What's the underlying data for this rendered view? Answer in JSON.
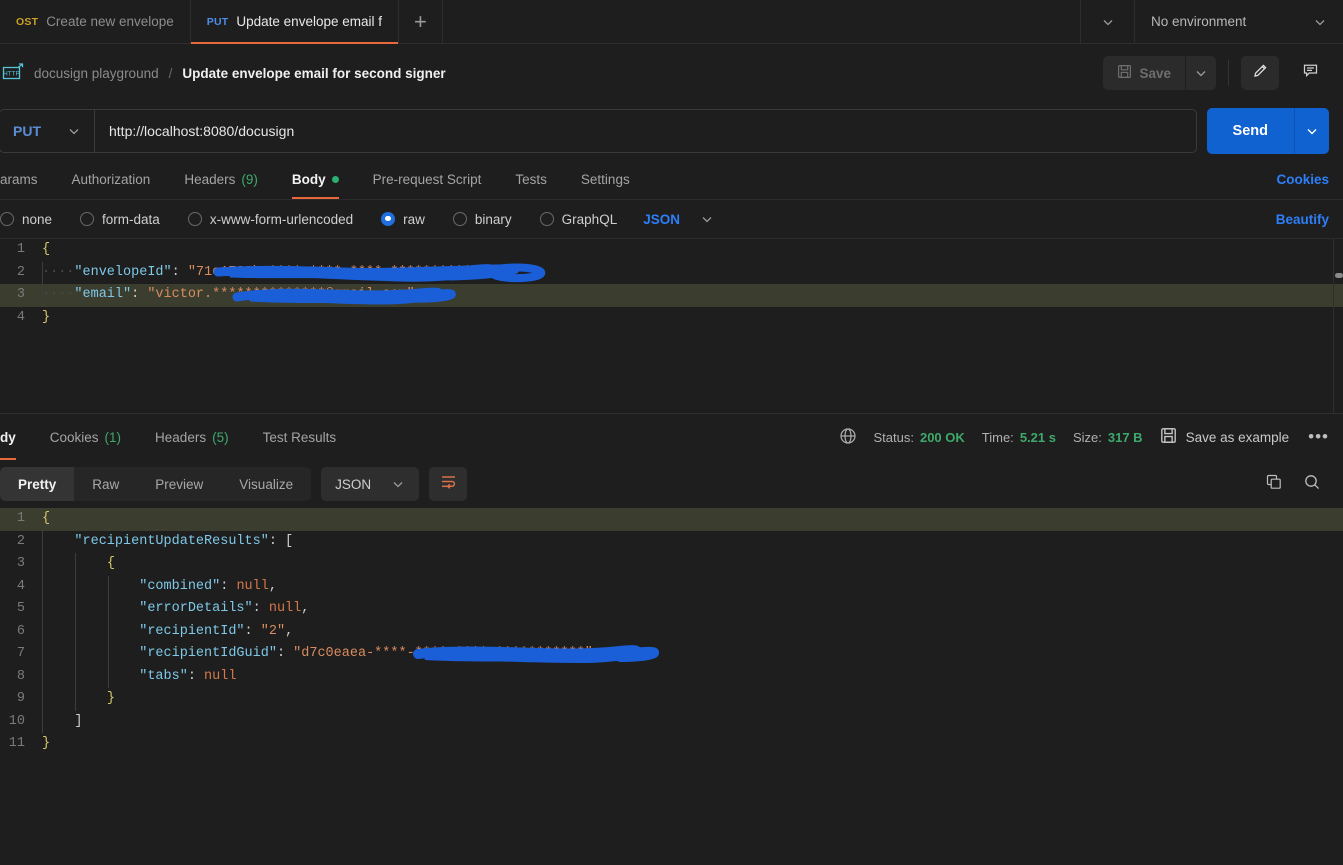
{
  "tabbar": {
    "tabs": [
      {
        "method": "OST",
        "label": "Create new envelope",
        "active": false
      },
      {
        "method": "PUT",
        "label": "Update envelope email f",
        "active": true
      }
    ],
    "add_label": "+",
    "environment": "No environment",
    "chevron_icon": "chevron-down-icon"
  },
  "breadcrumb": {
    "protocol_icon": "http-icon",
    "collection": "docusign playground",
    "separator": "/",
    "title": "Update envelope email for second signer",
    "save_label": "Save",
    "save_icon": "floppy-disk-icon",
    "caret_icon": "chevron-down-icon",
    "edit_icon": "pencil-icon",
    "comment_icon": "comment-icon"
  },
  "url": {
    "method": "PUT",
    "value": "http://localhost:8080/docusign",
    "send_label": "Send",
    "send_caret_icon": "chevron-down-icon",
    "method_caret_icon": "chevron-down-icon"
  },
  "request_tabs": {
    "items": [
      {
        "label": "arams",
        "count": "",
        "active": false,
        "dot": false
      },
      {
        "label": "Authorization",
        "count": "",
        "active": false,
        "dot": false
      },
      {
        "label": "Headers",
        "count": "(9)",
        "active": false,
        "dot": false
      },
      {
        "label": "Body",
        "count": "",
        "active": true,
        "dot": true
      },
      {
        "label": "Pre-request Script",
        "count": "",
        "active": false,
        "dot": false
      },
      {
        "label": "Tests",
        "count": "",
        "active": false,
        "dot": false
      },
      {
        "label": "Settings",
        "count": "",
        "active": false,
        "dot": false
      }
    ],
    "cookies_link": "Cookies"
  },
  "body_types": {
    "options": [
      {
        "label": "none",
        "selected": false
      },
      {
        "label": "form-data",
        "selected": false
      },
      {
        "label": "x-www-form-urlencoded",
        "selected": false
      },
      {
        "label": "raw",
        "selected": true
      },
      {
        "label": "binary",
        "selected": false
      },
      {
        "label": "GraphQL",
        "selected": false
      }
    ],
    "format": "JSON",
    "format_caret_icon": "chevron-down-icon",
    "beautify_link": "Beautify"
  },
  "request_body": {
    "lines": [
      {
        "n": "1",
        "text": "{"
      },
      {
        "n": "2",
        "text": "    \"envelopeId\": \"71e1733b-****-****-****-************\","
      },
      {
        "n": "3",
        "text": "    \"email\": \"victor.**************@gmail.com\""
      },
      {
        "n": "4",
        "text": "}"
      }
    ],
    "highlighted_line": 3
  },
  "response_tabs": {
    "items": [
      {
        "label": "dy",
        "count": "",
        "active": true
      },
      {
        "label": "Cookies",
        "count": "(1)",
        "active": false
      },
      {
        "label": "Headers",
        "count": "(5)",
        "active": false
      },
      {
        "label": "Test Results",
        "count": "",
        "active": false
      }
    ],
    "globe_icon": "globe-icon",
    "status_label": "Status:",
    "status_value": "200 OK",
    "time_label": "Time:",
    "time_value": "5.21 s",
    "size_label": "Size:",
    "size_value": "317 B",
    "save_example_label": "Save as example",
    "save_example_icon": "floppy-disk-icon",
    "more_icon": "ellipsis-icon"
  },
  "response_controls": {
    "views": [
      {
        "label": "Pretty",
        "active": true
      },
      {
        "label": "Raw",
        "active": false
      },
      {
        "label": "Preview",
        "active": false
      },
      {
        "label": "Visualize",
        "active": false
      }
    ],
    "format": "JSON",
    "format_caret_icon": "chevron-down-icon",
    "wrap_icon": "wrap-text-icon",
    "copy_icon": "copy-icon",
    "search_icon": "search-icon"
  },
  "response_body": {
    "highlighted_line": 1,
    "lines": [
      {
        "n": "1",
        "segments": [
          {
            "t": "{",
            "c": "k-brace"
          }
        ]
      },
      {
        "n": "2",
        "segments": [
          {
            "t": "    ",
            "c": "k-pun"
          },
          {
            "t": "\"recipientUpdateResults\"",
            "c": "k-key"
          },
          {
            "t": ": [",
            "c": "k-pun"
          }
        ]
      },
      {
        "n": "3",
        "segments": [
          {
            "t": "        ",
            "c": "k-pun"
          },
          {
            "t": "{",
            "c": "k-brace"
          }
        ]
      },
      {
        "n": "4",
        "segments": [
          {
            "t": "            ",
            "c": "k-pun"
          },
          {
            "t": "\"combined\"",
            "c": "k-key"
          },
          {
            "t": ": ",
            "c": "k-pun"
          },
          {
            "t": "null",
            "c": "k-null"
          },
          {
            "t": ",",
            "c": "k-pun"
          }
        ]
      },
      {
        "n": "5",
        "segments": [
          {
            "t": "            ",
            "c": "k-pun"
          },
          {
            "t": "\"errorDetails\"",
            "c": "k-key"
          },
          {
            "t": ": ",
            "c": "k-pun"
          },
          {
            "t": "null",
            "c": "k-null"
          },
          {
            "t": ",",
            "c": "k-pun"
          }
        ]
      },
      {
        "n": "6",
        "segments": [
          {
            "t": "            ",
            "c": "k-pun"
          },
          {
            "t": "\"recipientId\"",
            "c": "k-key"
          },
          {
            "t": ": ",
            "c": "k-pun"
          },
          {
            "t": "\"2\"",
            "c": "k-str"
          },
          {
            "t": ",",
            "c": "k-pun"
          }
        ]
      },
      {
        "n": "7",
        "segments": [
          {
            "t": "            ",
            "c": "k-pun"
          },
          {
            "t": "\"recipientIdGuid\"",
            "c": "k-key"
          },
          {
            "t": ": ",
            "c": "k-pun"
          },
          {
            "t": "\"d7c0eaea-****-****-****-***********\"",
            "c": "k-str"
          },
          {
            "t": ",",
            "c": "k-pun"
          }
        ]
      },
      {
        "n": "8",
        "segments": [
          {
            "t": "            ",
            "c": "k-pun"
          },
          {
            "t": "\"tabs\"",
            "c": "k-key"
          },
          {
            "t": ": ",
            "c": "k-pun"
          },
          {
            "t": "null",
            "c": "k-null"
          }
        ]
      },
      {
        "n": "9",
        "segments": [
          {
            "t": "        ",
            "c": "k-pun"
          },
          {
            "t": "}",
            "c": "k-brace"
          }
        ]
      },
      {
        "n": "10",
        "segments": [
          {
            "t": "    ",
            "c": "k-pun"
          },
          {
            "t": "]",
            "c": "k-pun"
          }
        ]
      },
      {
        "n": "11",
        "segments": [
          {
            "t": "}",
            "c": "k-brace"
          }
        ]
      }
    ]
  },
  "colors": {
    "accent_orange": "#e8683c",
    "send_blue": "#0f62cf",
    "link_blue": "#2d7ff9",
    "status_green": "#3ea96b",
    "redaction_blue": "#1a5fd8",
    "highlight_olive": "#3b3d2f"
  }
}
